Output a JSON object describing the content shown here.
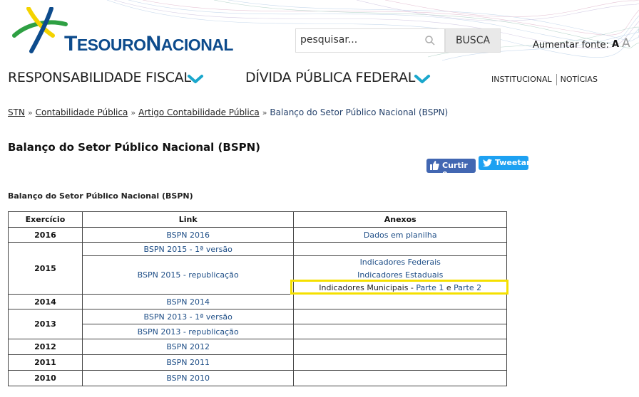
{
  "header": {
    "logo_alt": "Tesouro Nacional",
    "logo_parts": {
      "t": "T",
      "esouro": "ESOURO",
      "n": "N",
      "acional": "ACIONAL"
    },
    "search": {
      "placeholder": "pesquisar...",
      "button": "BUSCA"
    },
    "font_size": {
      "label": "Aumentar fonte:",
      "a_small": "A",
      "a_large": "A"
    },
    "colors": {
      "brand_blue": "#0d4b8c",
      "chevron": "#1aa7cc",
      "logo_green": "#2ea043",
      "logo_yellow": "#f4d300"
    }
  },
  "nav": {
    "items": [
      {
        "label": "RESPONSABILIDADE FISCAL"
      },
      {
        "label": "DÍVIDA PÚBLICA FEDERAL"
      }
    ],
    "top_links": [
      "INSTITUCIONAL",
      "NOTÍCIAS"
    ]
  },
  "breadcrumb": {
    "items": [
      "STN",
      "Contabilidade Pública",
      "Artigo Contabilidade Pública"
    ],
    "separator": "»",
    "current": "Balanço do Setor Público Nacional (BSPN)"
  },
  "page": {
    "title": "Balanço do Setor Público Nacional (BSPN)",
    "social": {
      "like": "Curtir 0",
      "tweet": "Tweetar"
    },
    "section_title": "Balanço do Setor Público Nacional (BSPN)"
  },
  "table": {
    "headers": [
      "Exercício",
      "Link",
      "Anexos"
    ],
    "rows": {
      "y2016": {
        "year": "2016",
        "link": "BSPN 2016",
        "anexo": "Dados em planilha"
      },
      "y2015": {
        "year": "2015",
        "link1": "BSPN 2015 - 1ª versão",
        "link2": "BSPN 2015 - republicação",
        "anexo_federais": "Indicadores Federais",
        "anexo_estaduais": "Indicadores Estaduais",
        "anexo_municipais_prefix": "Indicadores Municipais - ",
        "anexo_parte1": "Parte 1",
        "anexo_e": " e ",
        "anexo_parte2": "Parte 2"
      },
      "y2014": {
        "year": "2014",
        "link": "BSPN 2014"
      },
      "y2013": {
        "year": "2013",
        "link1": "BSPN 2013 - 1ª versão",
        "link2": "BSPN 2013 - republicação"
      },
      "y2012": {
        "year": "2012",
        "link": "BSPN 2012"
      },
      "y2011": {
        "year": "2011",
        "link": "BSPN 2011"
      },
      "y2010": {
        "year": "2010",
        "link": "BSPN 2010"
      }
    },
    "highlight_color": "#f5e000"
  }
}
